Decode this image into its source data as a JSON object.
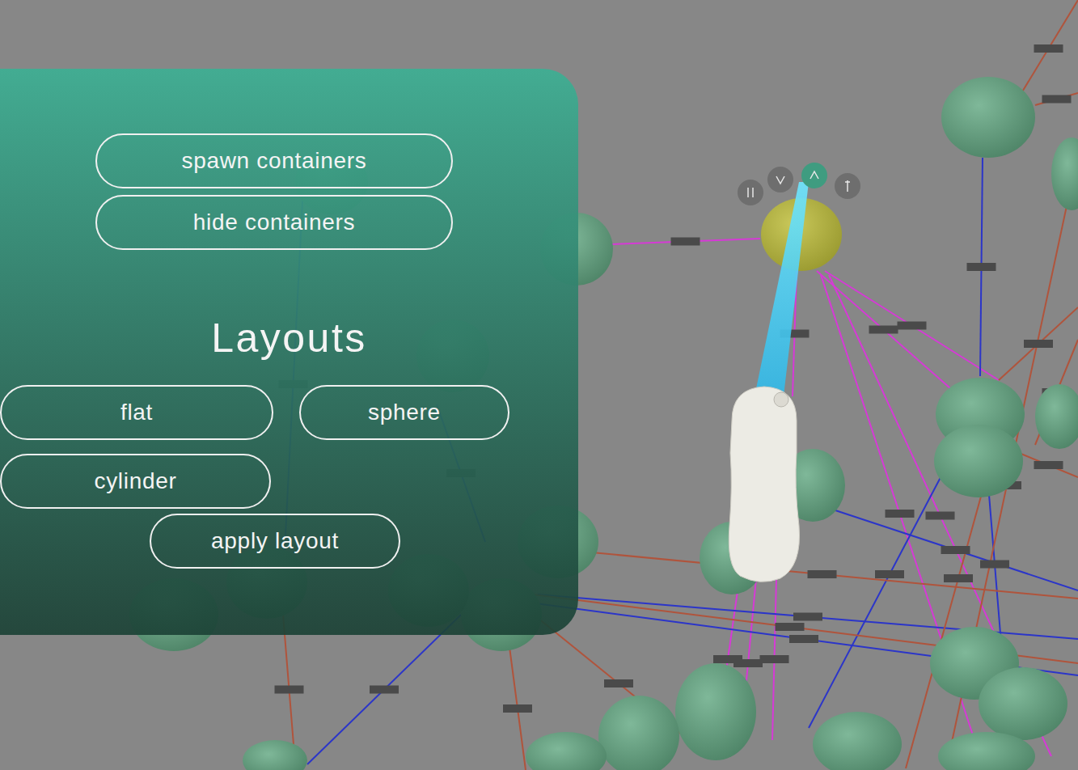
{
  "panel": {
    "buttons": [
      {
        "label": "spawn containers"
      },
      {
        "label": "hide containers"
      }
    ],
    "heading": "Layouts",
    "layouts": [
      {
        "label": "flat"
      },
      {
        "label": "sphere"
      },
      {
        "label": "cylinder"
      }
    ],
    "apply": {
      "label": "apply layout"
    }
  },
  "radial_menu": [
    {
      "selected": false
    },
    {
      "selected": false
    },
    {
      "selected": true
    },
    {
      "selected": false
    }
  ],
  "graph": {
    "nodes": [
      {
        "highlighted": false
      },
      {
        "highlighted": false
      },
      {
        "highlighted": false
      },
      {
        "highlighted": true
      },
      {
        "highlighted": false
      },
      {
        "highlighted": false
      },
      {
        "highlighted": false
      },
      {
        "highlighted": false
      },
      {
        "highlighted": false
      },
      {
        "highlighted": false
      },
      {
        "highlighted": false
      },
      {
        "highlighted": false
      },
      {
        "highlighted": false
      },
      {
        "highlighted": false
      },
      {
        "highlighted": false
      },
      {
        "highlighted": false
      },
      {
        "highlighted": false
      },
      {
        "highlighted": false
      },
      {
        "highlighted": false
      },
      {
        "highlighted": false
      },
      {
        "highlighted": false
      },
      {
        "highlighted": false
      },
      {
        "highlighted": false
      },
      {
        "highlighted": false
      }
    ],
    "edges": [
      {
        "color": "#d63ad6"
      },
      {
        "color": "#d63ad6"
      },
      {
        "color": "#d63ad6"
      },
      {
        "color": "#d63ad6"
      },
      {
        "color": "#d63ad6"
      },
      {
        "color": "#d63ad6"
      },
      {
        "color": "#d63ad6"
      },
      {
        "color": "#d63ad6"
      },
      {
        "color": "#d63ad6"
      },
      {
        "color": "#2b35c9"
      },
      {
        "color": "#2b35c9"
      },
      {
        "color": "#2b35c9"
      },
      {
        "color": "#2b35c9"
      },
      {
        "color": "#2b35c9"
      },
      {
        "color": "#2b35c9"
      },
      {
        "color": "#2b35c9"
      },
      {
        "color": "#2b35c9"
      },
      {
        "color": "#2b35c9"
      },
      {
        "color": "#b0543c"
      },
      {
        "color": "#b0543c"
      },
      {
        "color": "#b0543c"
      },
      {
        "color": "#b0543c"
      },
      {
        "color": "#b0543c"
      },
      {
        "color": "#b0543c"
      },
      {
        "color": "#b0543c"
      },
      {
        "color": "#b0543c"
      },
      {
        "color": "#b0543c"
      },
      {
        "color": "#b0543c"
      },
      {
        "color": "#b0543c"
      },
      {
        "color": "#b0543c"
      }
    ]
  }
}
